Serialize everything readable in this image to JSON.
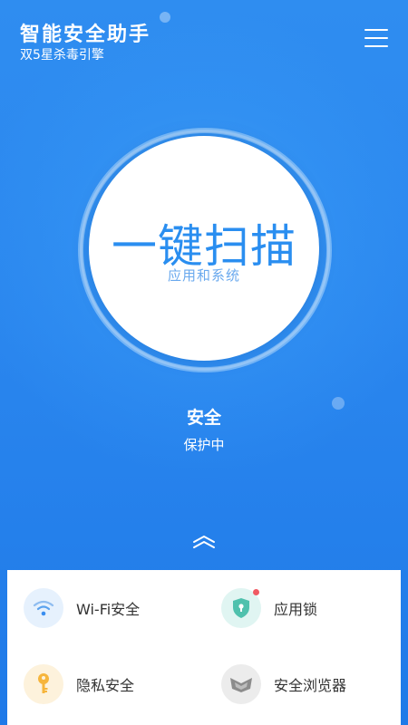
{
  "header": {
    "title": "智能安全助手",
    "subtitle": "双5星杀毒引擎"
  },
  "scan": {
    "title": "一键扫描",
    "subtitle": "应用和系统"
  },
  "status": {
    "title": "安全",
    "subtitle": "保护中"
  },
  "tools": [
    {
      "label": "Wi-Fi安全",
      "icon": "wifi-icon"
    },
    {
      "label": "应用锁",
      "icon": "shield-lock-icon",
      "badge": true
    },
    {
      "label": "隐私安全",
      "icon": "key-icon"
    },
    {
      "label": "安全浏览器",
      "icon": "browser-icon"
    }
  ],
  "colors": {
    "primary": "#2a86ee",
    "accent_text": "#2a8ef0",
    "badge": "#f05a63"
  }
}
